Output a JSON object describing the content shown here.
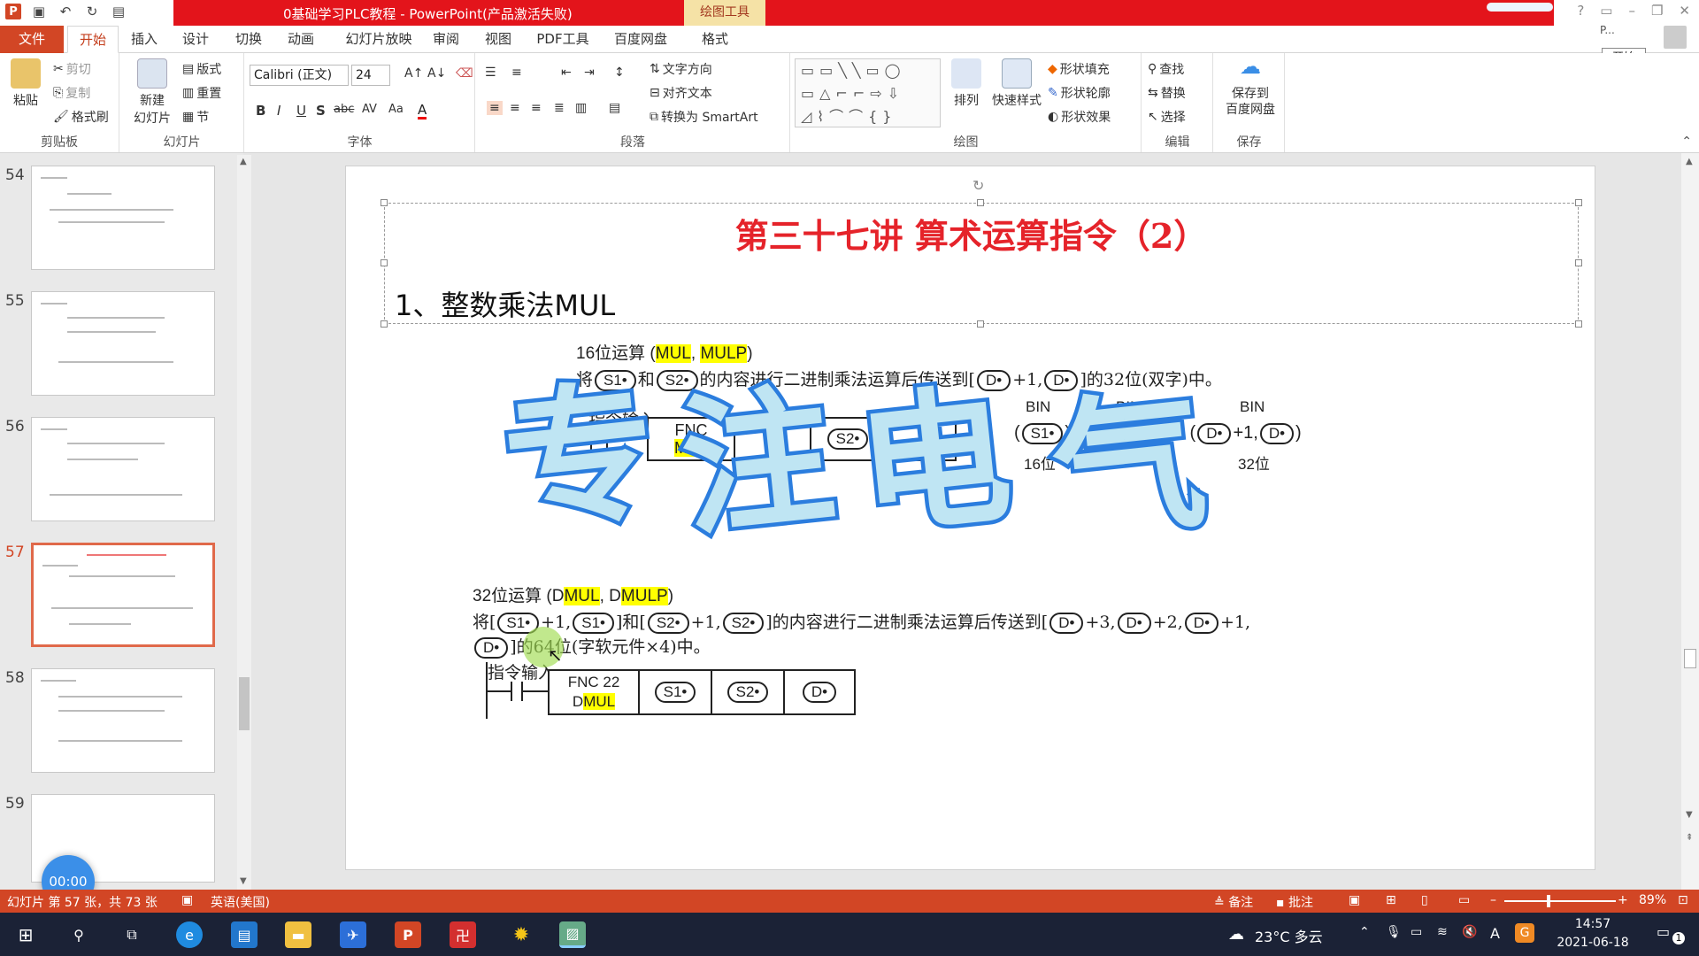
{
  "window": {
    "title": "0基础学习PLC教程 - PowerPoint(产品激活失败)",
    "drawing_tools": "绘图工具",
    "help": "?",
    "account": "P..."
  },
  "tabs": {
    "file": "文件",
    "items": [
      "开始",
      "插入",
      "设计",
      "切换",
      "动画",
      "幻灯片放映",
      "审阅",
      "视图",
      "PDF工具",
      "百度网盘",
      "格式"
    ],
    "active": "开始",
    "tooltip": "开始"
  },
  "ribbon": {
    "clipboard": {
      "name": "剪贴板",
      "paste": "粘贴",
      "cut": "剪切",
      "copy": "复制",
      "painter": "格式刷"
    },
    "slides": {
      "name": "幻灯片",
      "new_slide": "新建\n幻灯片",
      "layout": "版式",
      "reset": "重置",
      "section": "节"
    },
    "font": {
      "name": "字体",
      "family": "Calibri (正文)",
      "size": "24"
    },
    "paragraph": {
      "name": "段落",
      "text_direction": "文字方向",
      "align_text": "对齐文本",
      "smartart": "转换为 SmartArt"
    },
    "drawing": {
      "name": "绘图",
      "arrange": "排列",
      "quick_styles": "快速样式",
      "fill": "形状填充",
      "outline": "形状轮廓",
      "effects": "形状效果"
    },
    "editing": {
      "name": "编辑",
      "find": "查找",
      "replace": "替换",
      "select": "选择"
    },
    "save": {
      "name": "保存",
      "save_baidu": "保存到\n百度网盘"
    }
  },
  "thumbnails": {
    "numbers": [
      "54",
      "55",
      "56",
      "57",
      "58",
      "59"
    ],
    "active": "57"
  },
  "timer": "00:00",
  "slide": {
    "title": "第三十七讲   算术运算指令（2）",
    "heading": "1、整数乘法MUL",
    "s16": {
      "label_pre": "16位运算 (",
      "label_mul": "MUL",
      "label_sep": ", ",
      "label_mulp": "MULP",
      "label_post": ")",
      "desc_a": "将",
      "desc_b": "和",
      "desc_c": "的内容进行二进制乘法运算后传送到[",
      "desc_d": "+1,",
      "desc_e": "]的32位(双字)中。",
      "input": "指令输入",
      "fnc": "FNC",
      "fnc_sub": "MUL",
      "bin": "BIN",
      "arrow": "→",
      "bit16": "16位",
      "bit32": "32位",
      "plus1": "+1,"
    },
    "s32": {
      "label_pre": "32位运算 (",
      "label_d1": "D",
      "label_mul": "MUL",
      "label_sep": ", ",
      "label_d2": "D",
      "label_mulp": "MULP",
      "label_post": ")",
      "desc_a": "将[",
      "desc_p1": "+1,",
      "desc_b": "]和[",
      "desc_c": "]的内容进行二进制乘法运算后传送到[",
      "desc_p3": "+3,",
      "desc_p2": "+2,",
      "desc_d": "]的64位(字软元件×4)中。",
      "input": "指令输入",
      "fnc": "FNC 22",
      "fnc_d": "D",
      "fnc_sub": "MUL"
    },
    "ops": {
      "s1": "S1•",
      "s2": "S2•",
      "d": "D•"
    },
    "watermark": [
      "专",
      "注",
      "电",
      "气"
    ]
  },
  "status": {
    "slide_info": "幻灯片 第 57 张，共 73 张",
    "lang": "英语(美国)",
    "notes": "备注",
    "comments": "批注",
    "zoom": "89%"
  },
  "taskbar": {
    "weather": "23°C 多云",
    "time": "14:57",
    "date": "2021-06-18",
    "lang_ind": "A",
    "notif": "1"
  },
  "colors": {
    "accent": "#d24625",
    "title_red": "#e5232a",
    "highlight": "#ffff00",
    "watermark_fill": "#bfe5f3",
    "watermark_stroke": "#2b7dde"
  }
}
